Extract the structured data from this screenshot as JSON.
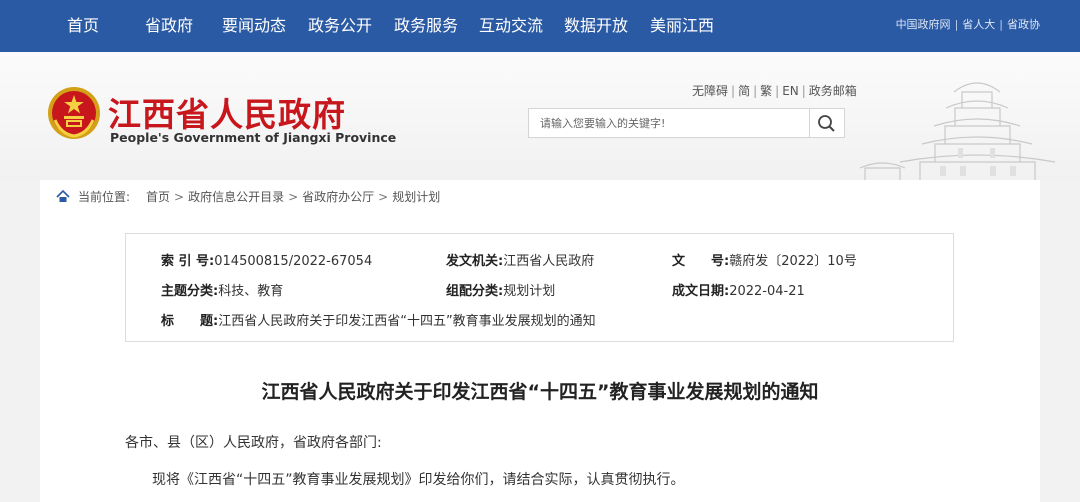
{
  "nav": {
    "items": [
      "首页",
      "省政府",
      "要闻动态",
      "政务公开",
      "政务服务",
      "互动交流",
      "数据开放",
      "美丽江西"
    ],
    "links": [
      "中国政府网",
      "省人大",
      "省政协"
    ]
  },
  "header": {
    "title": "江西省人民政府",
    "subtitle": "People's Government of Jiangxi Province",
    "tools": [
      "无障碍",
      "简",
      "繁",
      "EN",
      "政务邮箱"
    ],
    "search_placeholder": "请输入您要输入的关键字!",
    "brand_color": "#c8161d",
    "nav_color": "#2b5aa4"
  },
  "breadcrumb": {
    "label": "当前位置:",
    "items": [
      "首页",
      "政府信息公开目录",
      "省政府办公厅",
      "规划计划"
    ]
  },
  "meta": {
    "index_label": "索 引 号:",
    "index_value": "014500815/2022-67054",
    "issuer_label": "发文机关:",
    "issuer_value": "江西省人民政府",
    "docno_label": "文　　号:",
    "docno_value": "赣府发〔2022〕10号",
    "topic_label": "主题分类:",
    "topic_value": "科技、教育",
    "category_label": "组配分类:",
    "category_value": "规划计划",
    "date_label": "成文日期:",
    "date_value": "2022-04-21",
    "subject_label": "标　　题:",
    "subject_value": "江西省人民政府关于印发江西省“十四五”教育事业发展规划的通知"
  },
  "document": {
    "title": "江西省人民政府关于印发江西省“十四五”教育事业发展规划的通知",
    "salutation": "各市、县（区）人民政府，省政府各部门:",
    "body": "现将《江西省“十四五”教育事业发展规划》印发给你们，请结合实际，认真贯彻执行。"
  }
}
